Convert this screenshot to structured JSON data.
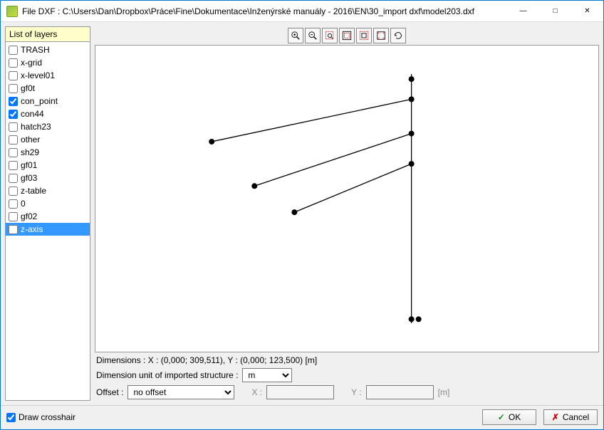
{
  "window": {
    "title": "File DXF : C:\\Users\\Dan\\Dropbox\\Práce\\Fine\\Dokumentace\\Inženýrské manuály - 2016\\EN\\30_import dxf\\model203.dxf"
  },
  "sidebar": {
    "header": "List of layers",
    "layers": [
      {
        "name": "TRASH",
        "checked": false,
        "selected": false
      },
      {
        "name": "x-grid",
        "checked": false,
        "selected": false
      },
      {
        "name": "x-level01",
        "checked": false,
        "selected": false
      },
      {
        "name": "gf0t",
        "checked": false,
        "selected": false
      },
      {
        "name": "con_point",
        "checked": true,
        "selected": false
      },
      {
        "name": "con44",
        "checked": true,
        "selected": false
      },
      {
        "name": "hatch23",
        "checked": false,
        "selected": false
      },
      {
        "name": "other",
        "checked": false,
        "selected": false
      },
      {
        "name": "sh29",
        "checked": false,
        "selected": false
      },
      {
        "name": "gf01",
        "checked": false,
        "selected": false
      },
      {
        "name": "gf03",
        "checked": false,
        "selected": false
      },
      {
        "name": "z-table",
        "checked": false,
        "selected": false
      },
      {
        "name": "0",
        "checked": false,
        "selected": false
      },
      {
        "name": "gf02",
        "checked": false,
        "selected": false
      },
      {
        "name": "z-axis",
        "checked": false,
        "selected": true
      }
    ]
  },
  "info": {
    "dimensions": "Dimensions :  X : (0,000; 309,511), Y : (0,000; 123,500) [m]",
    "unit_label": "Dimension unit of imported structure :",
    "unit_value": "m",
    "offset_label": "Offset :",
    "offset_value": "no offset",
    "x_label": "X :",
    "y_label": "Y :",
    "coord_unit": "[m]"
  },
  "footer": {
    "draw_crosshair": "Draw crosshair",
    "draw_crosshair_checked": true,
    "ok": "OK",
    "cancel": "Cancel"
  },
  "chart_data": {
    "type": "scatter",
    "title": "",
    "xlabel": "",
    "ylabel": "",
    "xlim": [
      0,
      309.511
    ],
    "ylim": [
      0,
      123.5
    ],
    "vertical_line_x": 200,
    "vertical_line_y": [
      0,
      123.5
    ],
    "points_on_vertical": [
      {
        "x": 200,
        "y": 121
      },
      {
        "x": 200,
        "y": 111
      },
      {
        "x": 200,
        "y": 94
      },
      {
        "x": 200,
        "y": 79
      },
      {
        "x": 200,
        "y": 2
      },
      {
        "x": 205,
        "y": 2
      }
    ],
    "branch_endpoints": [
      {
        "x": 60,
        "y": 90
      },
      {
        "x": 90,
        "y": 68
      },
      {
        "x": 118,
        "y": 55
      }
    ],
    "branches": [
      {
        "from": {
          "x": 200,
          "y": 111
        },
        "to": {
          "x": 60,
          "y": 90
        }
      },
      {
        "from": {
          "x": 200,
          "y": 94
        },
        "to": {
          "x": 90,
          "y": 68
        }
      },
      {
        "from": {
          "x": 200,
          "y": 79
        },
        "to": {
          "x": 118,
          "y": 55
        }
      }
    ]
  }
}
